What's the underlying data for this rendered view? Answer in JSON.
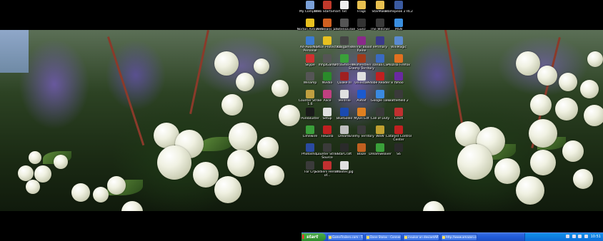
{
  "desktop": {
    "icons": [
      {
        "label": "My Computer",
        "icon": "computer-icon",
        "color": "#7aa0d8"
      },
      {
        "label": "Nero StartSmart",
        "icon": "nero-icon",
        "color": "#c0392b"
      },
      {
        "label": "txt",
        "icon": "text-file-icon",
        "color": "#eeeeee"
      },
      {
        "label": "Frags",
        "icon": "folder-icon",
        "color": "#e8c050"
      },
      {
        "label": "StarMaker",
        "icon": "star-icon",
        "color": "#e8c050"
      },
      {
        "label": "Teamspeak 2 RC2",
        "icon": "teamspeak-icon",
        "color": "#3a5aa0"
      },
      {
        "label": "Norton Antivirus",
        "icon": "norton-icon",
        "color": "#e8c020"
      },
      {
        "label": "NetBeans 5.5",
        "icon": "netbeans-icon",
        "color": "#d06020"
      },
      {
        "label": "Zextensa.exe",
        "icon": "exe-icon",
        "color": "#555555"
      },
      {
        "label": "Gunz",
        "icon": "gunz-icon",
        "color": "#333333"
      },
      {
        "label": "The Witcher",
        "icon": "witcher-icon",
        "color": "#3a3a3a"
      },
      {
        "label": "MSN",
        "icon": "msn-icon",
        "color": "#3a8fe0"
      },
      {
        "label": "Ad-Aware SE Personal",
        "icon": "adaware-icon",
        "color": "#3a7ad0"
      },
      {
        "label": "Norton Protection",
        "icon": "norton-icon",
        "color": "#e8c020"
      },
      {
        "label": "Kbkgame",
        "icon": "game-icon",
        "color": "#444444"
      },
      {
        "label": "Winrar Blood Raine",
        "icon": "winrar-icon",
        "color": "#8a2a8a"
      },
      {
        "label": "ePrimary",
        "icon": "app-icon",
        "color": "#3a3a8a"
      },
      {
        "label": "WinMagic",
        "icon": "app-icon",
        "color": "#5a8ad0"
      },
      {
        "label": "Skype",
        "icon": "skype-icon",
        "color": "#d03030"
      },
      {
        "label": "mhplGame",
        "icon": "game-icon",
        "color": "#555555"
      },
      {
        "label": "UltraSmsFree",
        "icon": "sms-icon",
        "color": "#3aa03a"
      },
      {
        "label": "Wolfenstein Enemy Territory",
        "icon": "wolf-icon",
        "color": "#a03a1a"
      },
      {
        "label": "sanaa.CS",
        "icon": "app-icon",
        "color": "#3a6ac0"
      },
      {
        "label": "Mozilla Firefox",
        "icon": "firefox-icon",
        "color": "#e07020"
      },
      {
        "label": "Winamp",
        "icon": "winamp-icon",
        "color": "#555555"
      },
      {
        "label": "Nvidia",
        "icon": "nvidia-icon",
        "color": "#2a8a2a"
      },
      {
        "label": "Quake III",
        "icon": "quake-icon",
        "color": "#a02020"
      },
      {
        "label": "Uninstall",
        "icon": "app-icon",
        "color": "#e0e0e0"
      },
      {
        "label": "Adobe Reader 8",
        "icon": "adobe-icon",
        "color": "#c02020"
      },
      {
        "label": "Yahoo",
        "icon": "yahoo-icon",
        "color": "#6a2aa0"
      },
      {
        "label": "Counter Strike 1.6",
        "icon": "cs-icon",
        "color": "#c0a040"
      },
      {
        "label": "Alice",
        "icon": "app-icon",
        "color": "#c04080"
      },
      {
        "label": "Ventrilo",
        "icon": "ventrilo-icon",
        "color": "#e0e0e0"
      },
      {
        "label": "Autoit",
        "icon": "bluetooth-icon",
        "color": "#1a5ad0"
      },
      {
        "label": "Google Talk",
        "icon": "gtalk-icon",
        "color": "#3a8ae0"
      },
      {
        "label": "Battlefield 2",
        "icon": "bf2-icon",
        "color": "#3a3a3a"
      },
      {
        "label": "PunkBuster",
        "icon": "pb-icon",
        "color": "#1a1a1a"
      },
      {
        "label": "Setup",
        "icon": "setup-icon",
        "color": "#e0e0e0"
      },
      {
        "label": "BlueSoleil",
        "icon": "bluetooth-icon",
        "color": "#1a4ab0"
      },
      {
        "label": "MyDs Edt",
        "icon": "app-icon",
        "color": "#e08020"
      },
      {
        "label": "Call of Duty",
        "icon": "cod-icon",
        "color": "#3a3a3a"
      },
      {
        "label": "CoDX",
        "icon": "app-icon",
        "color": "#c03030"
      },
      {
        "label": "Limewire",
        "icon": "limewire-icon",
        "color": "#3aa03a"
      },
      {
        "label": "FileZilla",
        "icon": "filezilla-icon",
        "color": "#c02020"
      },
      {
        "label": "Dreams",
        "icon": "app-icon",
        "color": "#c0c0c0"
      },
      {
        "label": "Enemy Territory",
        "icon": "et-icon",
        "color": "#3a3a3a"
      },
      {
        "label": "WoW",
        "icon": "wow-icon",
        "color": "#c0a030"
      },
      {
        "label": "Catalyst Control Center",
        "icon": "ati-icon",
        "color": "#c02020"
      },
      {
        "label": "Photoshop",
        "icon": "photoshop-icon",
        "color": "#2a4aa0"
      },
      {
        "label": "Counter Strike Source",
        "icon": "css-icon",
        "color": "#3a3a3a"
      },
      {
        "label": "StarCraft",
        "icon": "starcraft-icon",
        "color": "#2a2a2a"
      },
      {
        "label": "Blaze",
        "icon": "app-icon",
        "color": "#c06020"
      },
      {
        "label": "Dreamweaver",
        "icon": "dreamweaver-icon",
        "color": "#3aa03a"
      },
      {
        "label": "S6",
        "icon": "s6-icon",
        "color": "#2a2a2a"
      },
      {
        "label": "Far Cry",
        "icon": "farcry-icon",
        "color": "#3a3a3a"
      },
      {
        "label": "Soldiers Heroes of...",
        "icon": "soldiers-icon",
        "color": "#c03030"
      },
      {
        "label": "shooter.jpg",
        "icon": "image-file-icon",
        "color": "#e0e0e0"
      }
    ]
  },
  "taskbar": {
    "start_label": "start",
    "tasks": [
      {
        "label": "GameTrailers.com - T..."
      },
      {
        "label": "Dane Stolov - Conner..."
      },
      {
        "label": "insukor on deviantART"
      },
      {
        "label": "http://www.amazon.co..."
      }
    ],
    "clock": "10:51"
  }
}
